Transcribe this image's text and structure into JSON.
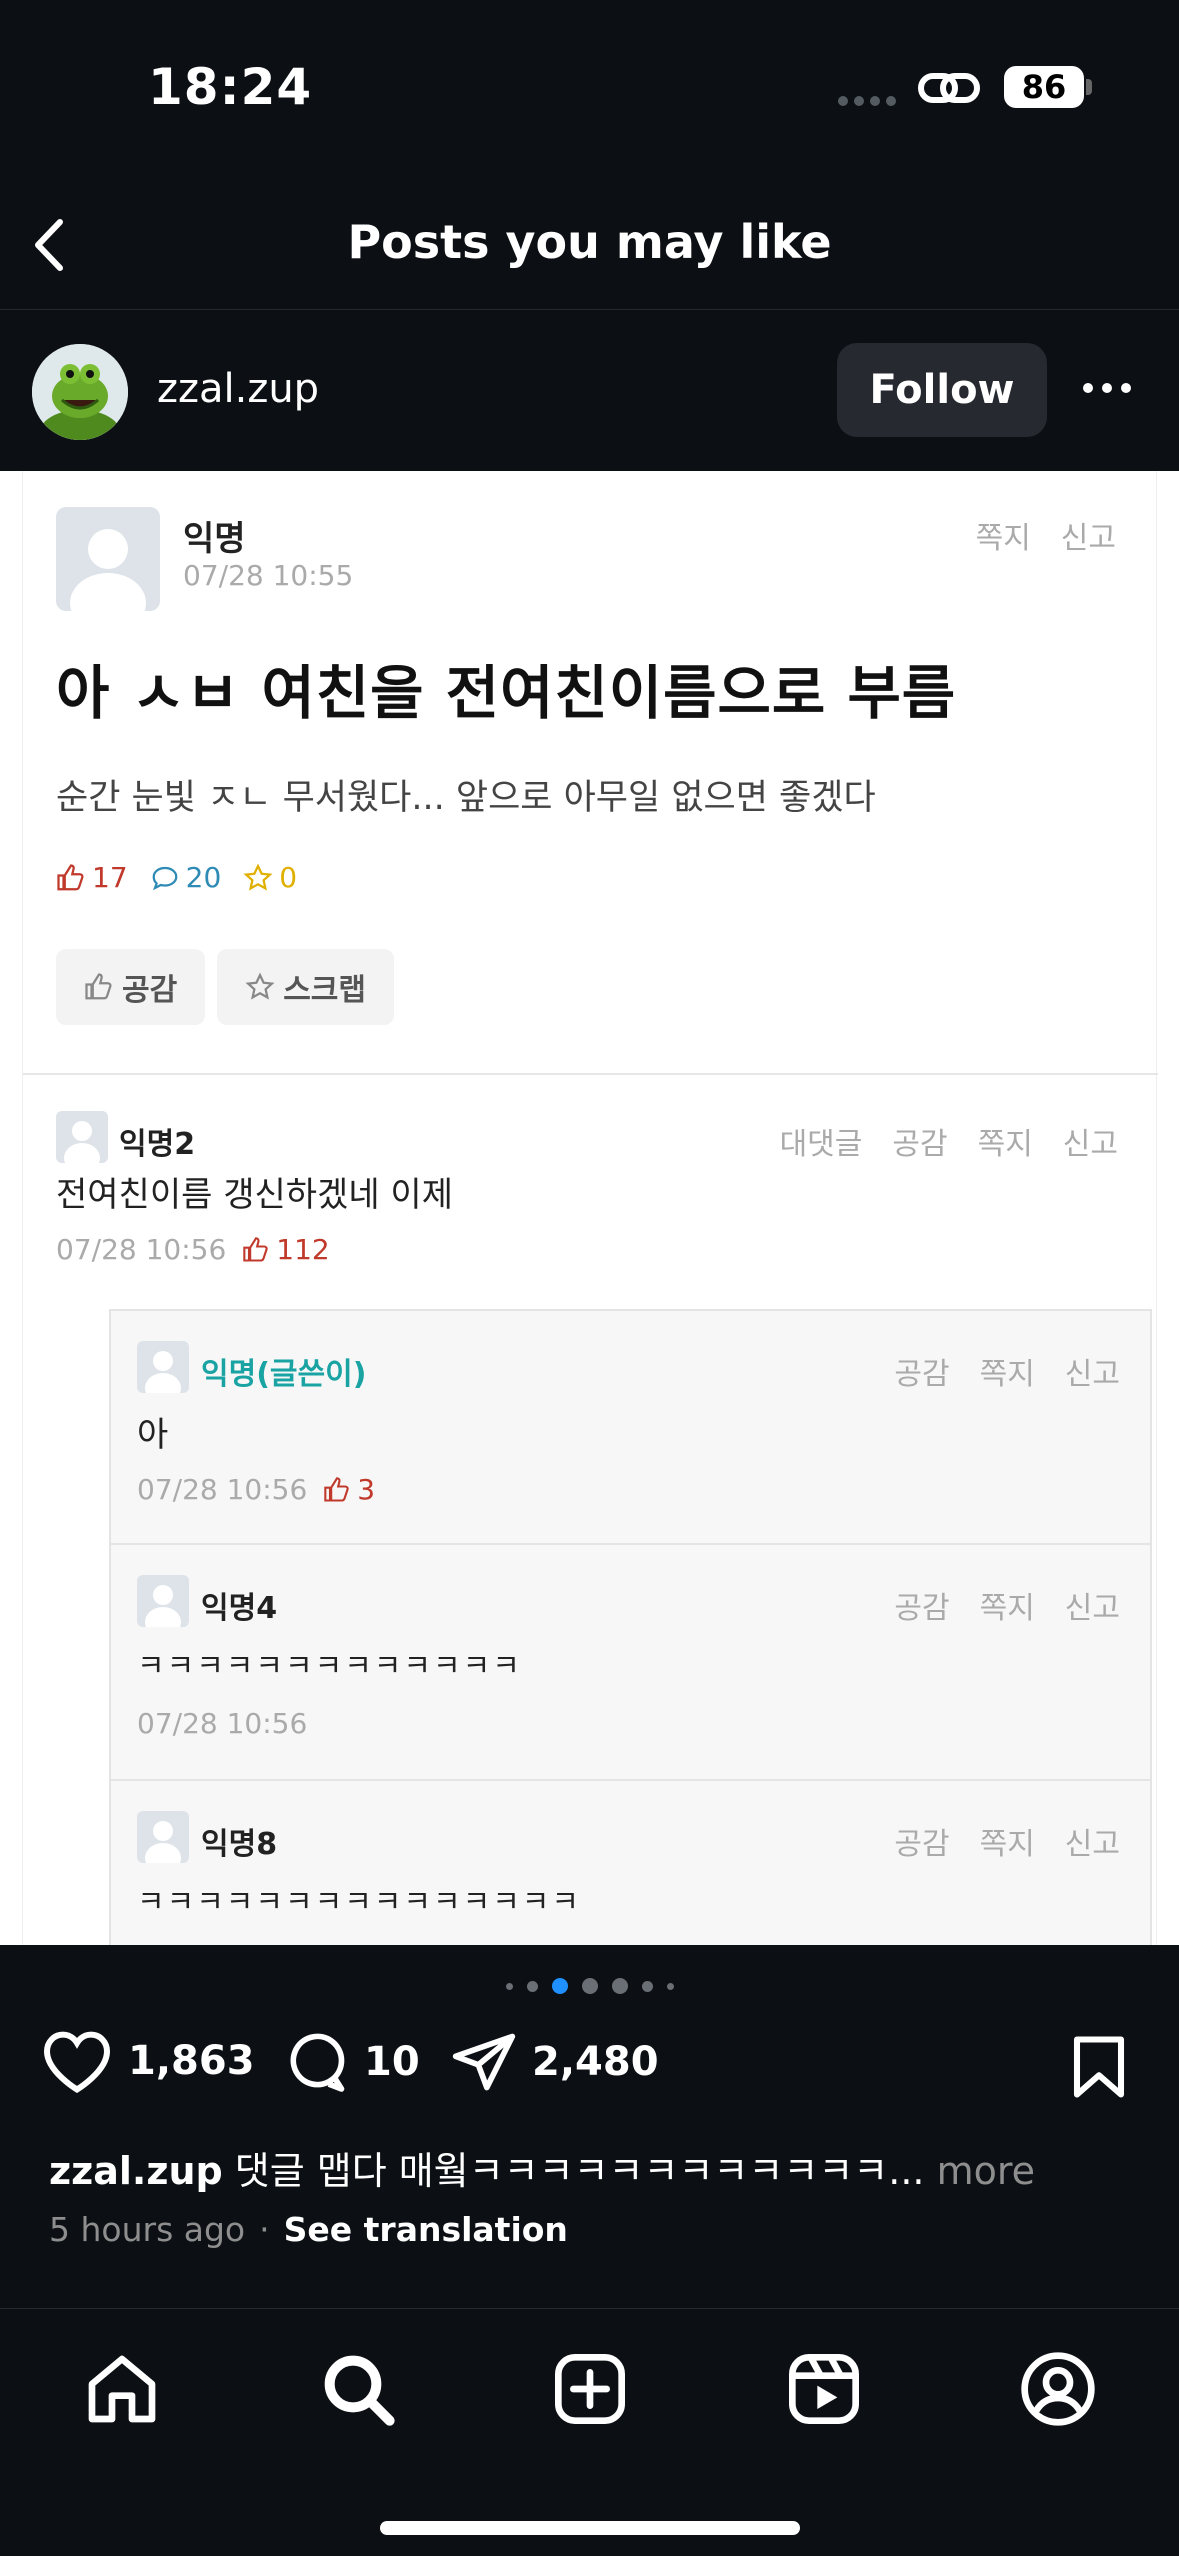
{
  "status_bar": {
    "time": "18:24",
    "battery": "86"
  },
  "header": {
    "title": "Posts you may like"
  },
  "account": {
    "username": "zzal.zup",
    "follow_label": "Follow"
  },
  "post_image": {
    "author": "익명",
    "date": "07/28 10:55",
    "actions": [
      "쪽지",
      "신고"
    ],
    "title": "아 ㅅㅂ 여친을 전여친이름으로 부름",
    "body": "순간 눈빛 ㅈㄴ 무서웠다... 앞으로 아무일 없으면 좋겠다",
    "likes": "17",
    "comments": "20",
    "scraps": "0",
    "btn_like": "공감",
    "btn_scrap": "스크랩",
    "comment_list": [
      {
        "name": "익명2",
        "actions": [
          "대댓글",
          "공감",
          "쪽지",
          "신고"
        ],
        "text": "전여친이름 갱신하겠네 이제",
        "date": "07/28 10:56",
        "likes": "112"
      },
      {
        "name": "익명(글쓴이)",
        "actions": [
          "공감",
          "쪽지",
          "신고"
        ],
        "text": "아",
        "date": "07/28 10:56",
        "likes": "3"
      },
      {
        "name": "익명4",
        "actions": [
          "공감",
          "쪽지",
          "신고"
        ],
        "text": "ㅋㅋㅋㅋㅋㅋㅋㅋㅋㅋㅋㅋㅋ",
        "date": "07/28 10:56"
      },
      {
        "name": "익명8",
        "actions": [
          "공감",
          "쪽지",
          "신고"
        ],
        "text": "ㅋㅋㅋㅋㅋㅋㅋㅋㅋㅋㅋㅋㅋㅋㅋ"
      }
    ]
  },
  "engagement": {
    "likes": "1,863",
    "comments": "10",
    "shares": "2,480"
  },
  "caption": {
    "username": "zzal.zup",
    "text": " 댓글 맵다 매웤ㅋㅋㅋㅋㅋㅋㅋㅋㅋㅋㅋㅋ...",
    "more": " more"
  },
  "meta": {
    "time_ago": "5 hours ago",
    "dot": "·",
    "see_translation": "See translation"
  },
  "tabs": [
    "home-icon",
    "search-icon",
    "create-icon",
    "reels-icon",
    "profile-icon"
  ]
}
